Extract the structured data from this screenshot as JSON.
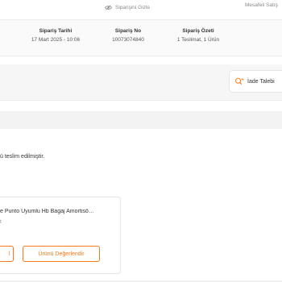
{
  "header": {
    "hide_order": "Siparişini Gizle",
    "contract": "Mesafeli Satış"
  },
  "summary": {
    "date_label": "Sipariş Tarihi",
    "date_value": "17 Mart 2025 - 10:06",
    "no_label": "Sipariş No",
    "no_value": "10073074840",
    "summary_label": "Sipariş Özeti",
    "summary_value": "1 Teslimat, 1 Ürün"
  },
  "actions": {
    "return_label": "İade Talebi"
  },
  "delivery": {
    "status_text": "ü teslim edilmiştir."
  },
  "product": {
    "name": "e Punto Uyumlu Hb Bagaj Amortisö…",
    "sub": "t",
    "left_button": "l",
    "review_button": "Ürünü Değerlendir"
  },
  "colors": {
    "accent": "#f27a1a"
  },
  "icons": {
    "hide": "eye-slash-icon",
    "return": "search-return-icon"
  }
}
